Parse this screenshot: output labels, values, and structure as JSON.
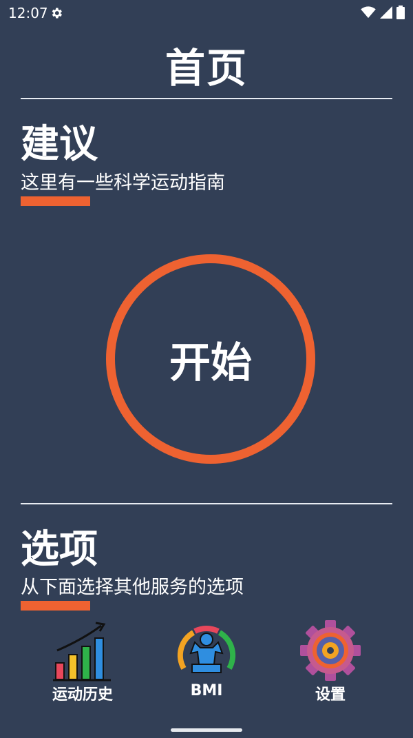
{
  "status_bar": {
    "time": "12:07"
  },
  "header": {
    "title": "首页"
  },
  "suggestions": {
    "title": "建议",
    "subtitle": "这里有一些科学运动指南"
  },
  "start_button": {
    "label": "开始"
  },
  "options": {
    "title": "选项",
    "subtitle": "从下面选择其他服务的选项"
  },
  "nav": [
    {
      "label": "运动历史",
      "icon": "bar-chart-icon"
    },
    {
      "label": "BMI",
      "icon": "bmi-gauge-icon"
    },
    {
      "label": "设置",
      "icon": "settings-gear-icon"
    }
  ],
  "colors": {
    "background": "#323f56",
    "accent": "#ee6231",
    "text": "#ffffff"
  }
}
